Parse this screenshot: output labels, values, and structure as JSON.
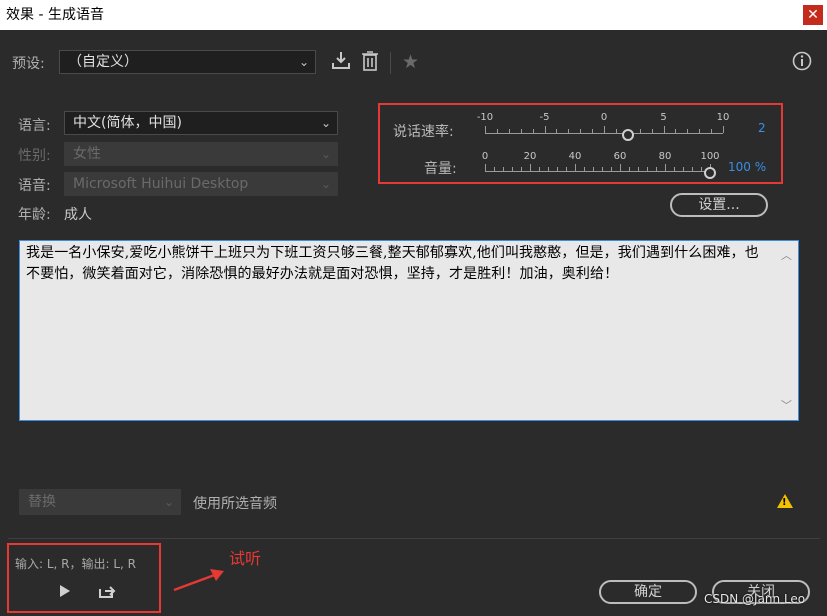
{
  "window": {
    "title": "效果 - 生成语音",
    "close": "✕"
  },
  "preset": {
    "label": "预设:",
    "value": "（自定义）"
  },
  "form": {
    "language_label": "语言:",
    "language_value": "中文(简体，中国)",
    "gender_label": "性别:",
    "gender_value": "女性",
    "voice_label": "语音:",
    "voice_value": "Microsoft Huihui Desktop",
    "age_label": "年龄:",
    "age_value": "成人"
  },
  "speech_rate": {
    "label": "说话速率:",
    "ticks": [
      "-10",
      "-5",
      "0",
      "5",
      "10"
    ],
    "min": -10,
    "max": 10,
    "value": 2,
    "value_text": "2"
  },
  "volume": {
    "label": "音量:",
    "ticks": [
      "0",
      "20",
      "40",
      "60",
      "80",
      "100"
    ],
    "min": 0,
    "max": 100,
    "value": 100,
    "value_text": "100 %"
  },
  "settings_button": "设置...",
  "text": "我是一名小保安,爱吃小熊饼干上班只为下班工资只够三餐,整天郁郁寡欢,他们叫我憨憨，但是，我们遇到什么困难，也不要怕，微笑着面对它，消除恐惧的最好办法就是面对恐惧，坚持，才是胜利！加油，奥利给！",
  "replace": {
    "select_value": "替换",
    "label": "使用所选音频"
  },
  "footer": {
    "io_text": "输入: L, R，输出: L, R",
    "ok": "确定",
    "close": "关闭"
  },
  "annotation": {
    "text": "试听"
  },
  "watermark": "CSDN @Jann Leo",
  "colors": {
    "accent": "#3a8ee6",
    "highlight": "#e53935",
    "warning": "#f2c200"
  }
}
